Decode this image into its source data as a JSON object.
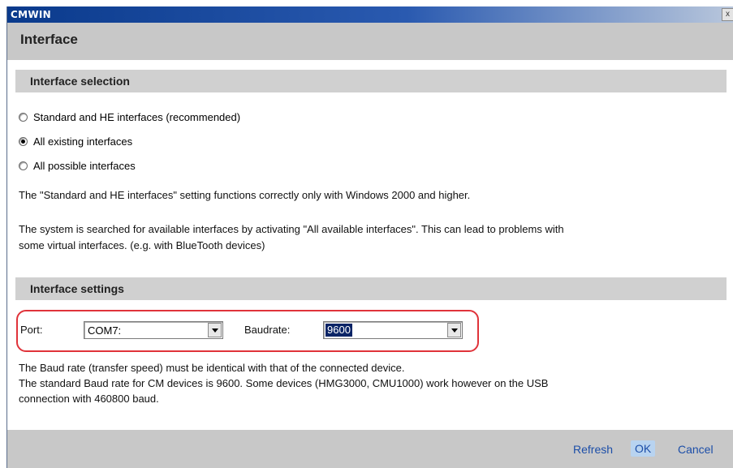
{
  "window": {
    "title": "CMWIN",
    "close_glyph": "x"
  },
  "header": {
    "title": "Interface"
  },
  "interface_selection": {
    "heading": "Interface selection",
    "options": [
      {
        "label": "Standard and HE interfaces (recommended)",
        "checked": false
      },
      {
        "label": "All existing interfaces",
        "checked": true
      },
      {
        "label": "All possible interfaces",
        "checked": false
      }
    ],
    "note1": "The \"Standard and HE interfaces\" setting functions correctly only with Windows 2000 and higher.",
    "note2_line1": "The system is searched for available interfaces by activating \"All available interfaces\". This can lead to problems with",
    "note2_line2": "some virtual interfaces. (e.g. with BlueTooth devices)"
  },
  "interface_settings": {
    "heading": "Interface settings",
    "port_label": "Port:",
    "port_value": "COM7:",
    "baud_label": "Baudrate:",
    "baud_value": "9600",
    "info_line1": "The Baud rate (transfer speed) must be identical with that of the connected device.",
    "info_line2": "The standard Baud rate for CM devices is 9600. Some devices (HMG3000, CMU1000) work however on the USB",
    "info_line3": "connection with 460800 baud."
  },
  "footer": {
    "refresh_label": "Refresh",
    "ok_label": "OK",
    "cancel_label": "Cancel"
  },
  "colors": {
    "title_bar": "#0a3a8c",
    "header_bg": "#c8c8c8",
    "section_bg": "#d0d0d0",
    "highlight_border": "#e0333a",
    "link_text": "#1c4ea8",
    "selected_bg": "#0a2466"
  }
}
